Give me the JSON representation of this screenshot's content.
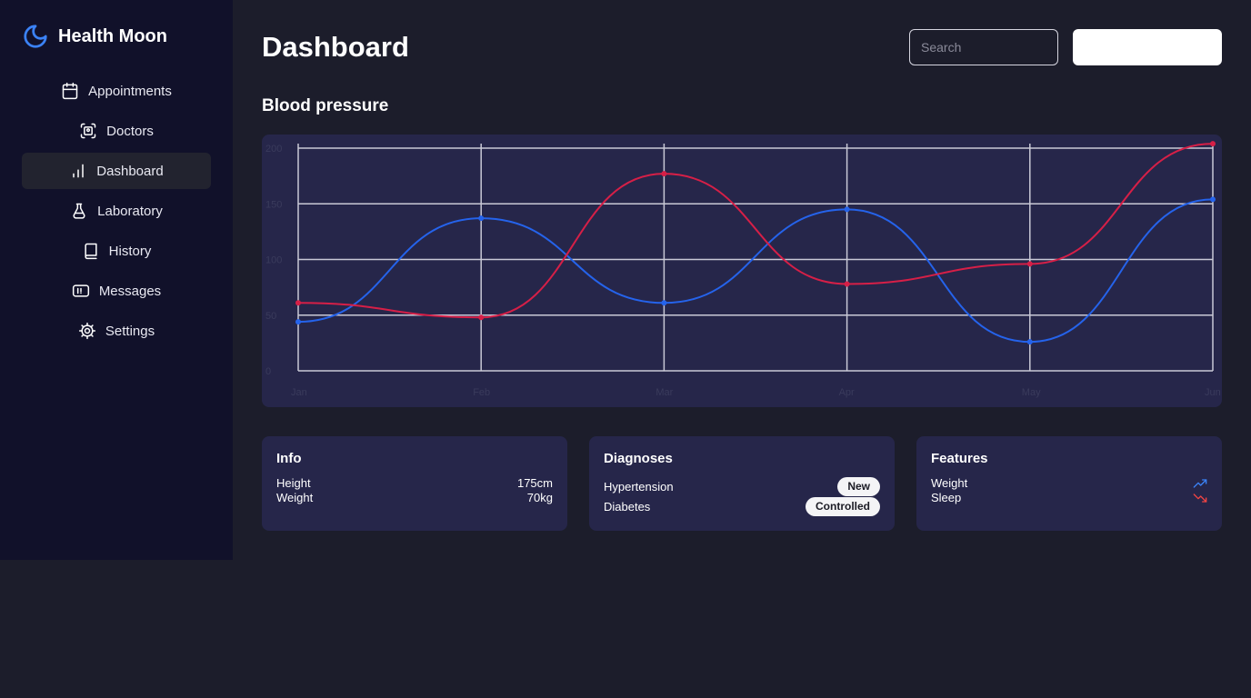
{
  "brand": {
    "name": "Health Moon",
    "icon": "moon-icon",
    "accent": "#3b82f6"
  },
  "nav": {
    "items": [
      {
        "label": "Appointments",
        "icon": "calendar-icon"
      },
      {
        "label": "Doctors",
        "icon": "scan-face-icon"
      },
      {
        "label": "Dashboard",
        "icon": "bar-chart-icon",
        "active": true
      },
      {
        "label": "Laboratory",
        "icon": "flask-icon"
      },
      {
        "label": "History",
        "icon": "book-icon"
      },
      {
        "label": "Messages",
        "icon": "message-box-icon"
      },
      {
        "label": "Settings",
        "icon": "gear-icon"
      }
    ]
  },
  "header": {
    "title": "Dashboard",
    "search_placeholder": "Search",
    "button_label": ""
  },
  "chart_section": {
    "title": "Blood pressure"
  },
  "chart_data": {
    "type": "line",
    "title": "",
    "xlabel": "",
    "ylabel": "",
    "categories": [
      "Jan",
      "Feb",
      "Mar",
      "Apr",
      "May",
      "Jun"
    ],
    "ylim": [
      0,
      200
    ],
    "yticks": [
      0,
      50,
      100,
      150,
      200
    ],
    "grid": true,
    "series": [
      {
        "color": "#2563eb",
        "values": [
          44,
          137,
          61,
          145,
          26,
          154
        ]
      },
      {
        "color": "#d61f47",
        "values": [
          61,
          48,
          177,
          78,
          96,
          204
        ]
      }
    ]
  },
  "info": {
    "title": "Info",
    "rows": [
      {
        "label": "Height",
        "value": "175cm"
      },
      {
        "label": "Weight",
        "value": "70kg"
      }
    ]
  },
  "diagnoses": {
    "title": "Diagnoses",
    "rows": [
      {
        "label": "Hypertension",
        "badge": "New"
      },
      {
        "label": "Diabetes",
        "badge": "Controlled"
      }
    ]
  },
  "features": {
    "title": "Features",
    "rows": [
      {
        "label": "Weight",
        "trend": "trending-up-icon",
        "color": "#3b82f6"
      },
      {
        "label": "Sleep",
        "trend": "trending-down-icon",
        "color": "#ef4444"
      }
    ]
  }
}
